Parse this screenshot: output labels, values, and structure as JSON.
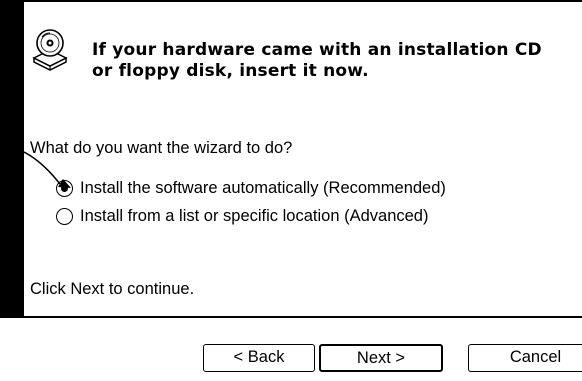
{
  "wizard": {
    "heading_line1": "If your hardware came with an installation CD",
    "heading_line2": "or floppy disk, insert it now.",
    "question": "What do you want the wizard to do?",
    "options": [
      {
        "label": "Install the software automatically (Recommended)",
        "selected": true
      },
      {
        "label": "Install from a list or specific location (Advanced)",
        "selected": false
      }
    ],
    "instruction": "Click Next to continue."
  },
  "buttons": {
    "back": "< Back",
    "next": "Next >",
    "cancel": "Cancel"
  },
  "icons": {
    "heading_icon": "cd-icon",
    "annotation": "arrow-icon"
  }
}
